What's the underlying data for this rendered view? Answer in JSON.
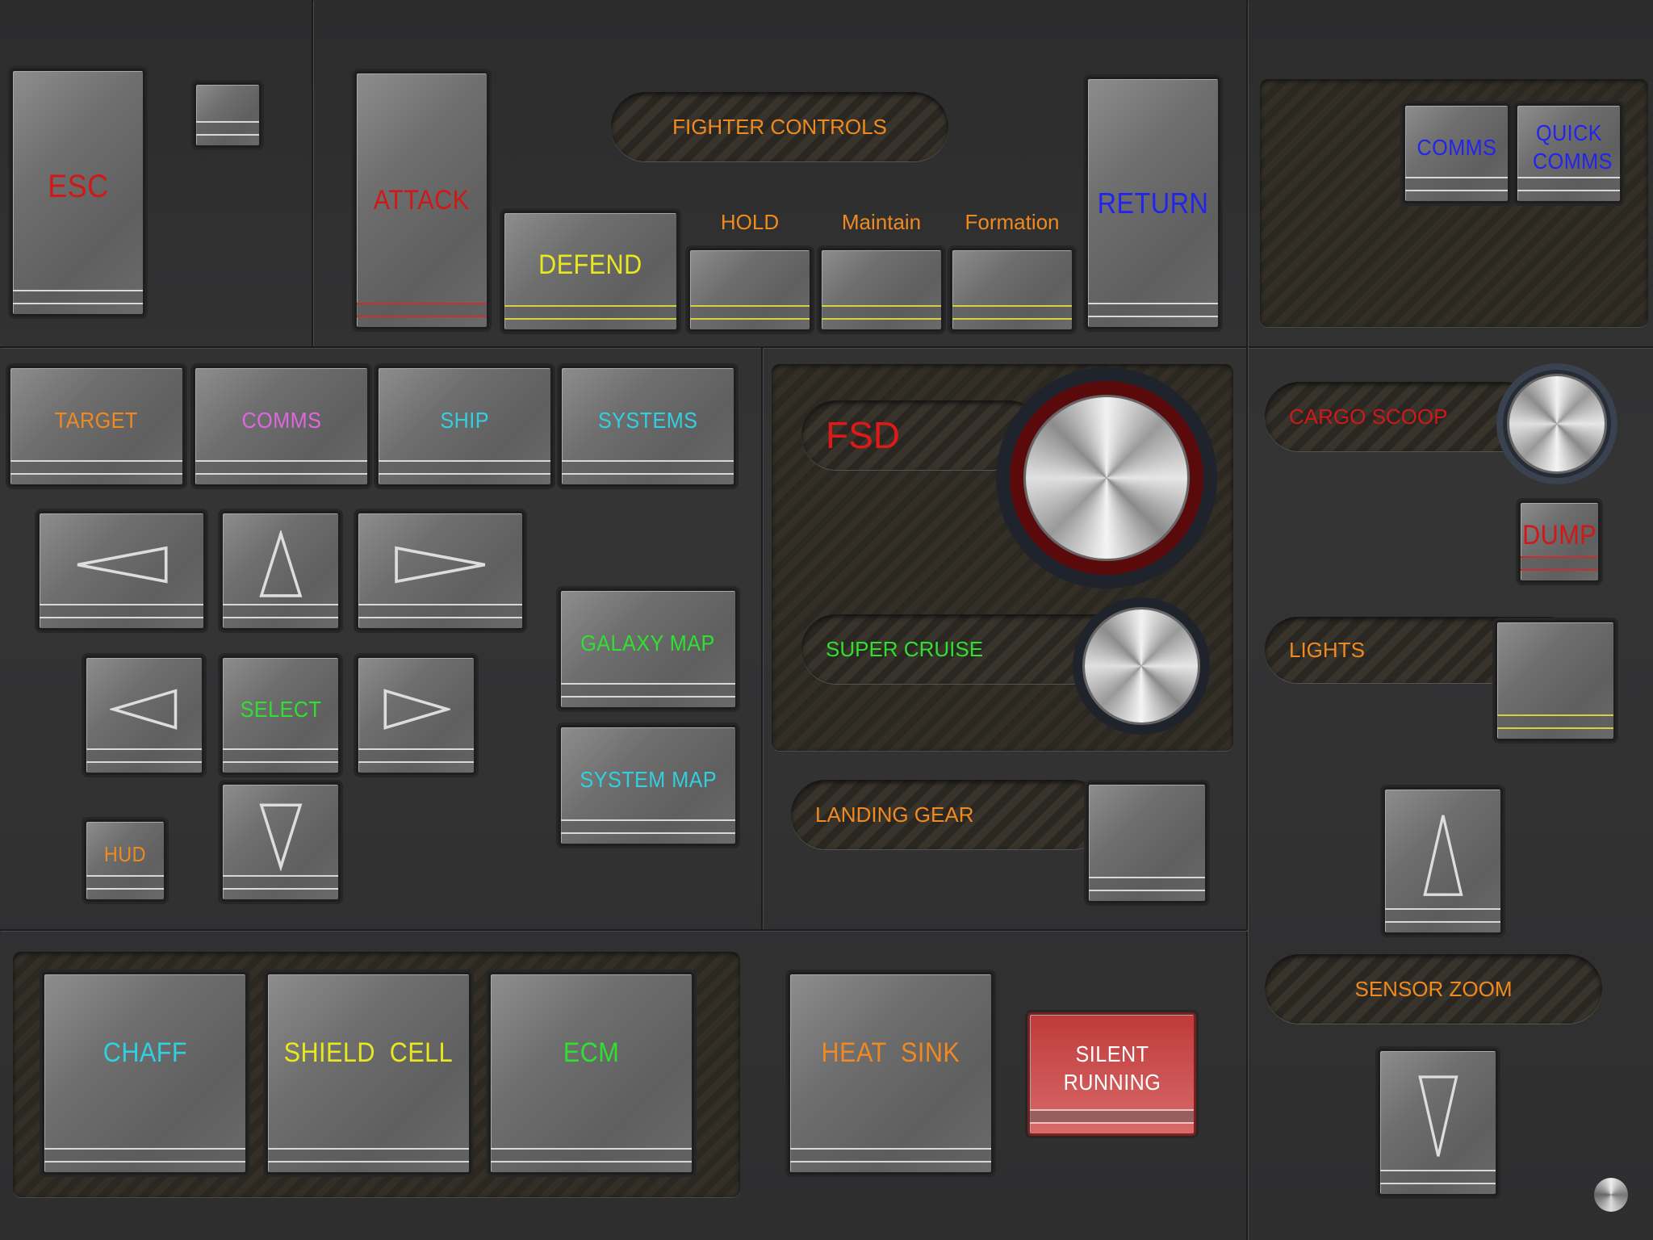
{
  "colors": {
    "red": "#d01818",
    "orange": "#f08a20",
    "yellow": "#e8e820",
    "blue": "#2323ee",
    "magenta": "#e066e0",
    "cyan": "#30d0e0",
    "green": "#30e030"
  },
  "top": {
    "esc": "ESC",
    "attack": "ATTACK",
    "fighter_controls": "FIGHTER CONTROLS",
    "defend": "DEFEND",
    "hold": "HOLD",
    "maintain": "Maintain",
    "formation": "Formation",
    "return": "RETURN",
    "comms": "COMMS",
    "quick_comms": "QUICK COMMS"
  },
  "nav": {
    "target": "TARGET",
    "comms": "COMMS",
    "ship": "SHIP",
    "systems": "SYSTEMS",
    "select": "SELECT",
    "hud": "HUD",
    "galaxy_map": "GALAXY MAP",
    "system_map": "SYSTEM MAP"
  },
  "flight": {
    "fsd": "FSD",
    "super_cruise": "SUPER CRUISE",
    "landing_gear": "LANDING GEAR",
    "cargo_scoop": "CARGO SCOOP",
    "dump": "DUMP",
    "lights": "LIGHTS",
    "sensor_zoom": "SENSOR ZOOM"
  },
  "defense": {
    "chaff": "CHAFF",
    "shield_cell": "SHIELD  CELL",
    "ecm": "ECM",
    "heat_sink": "HEAT  SINK",
    "silent_running": "SILENT RUNNING"
  },
  "icons": [
    "arrow-left-icon",
    "arrow-up-icon",
    "arrow-right-icon",
    "arrow-down-icon"
  ]
}
